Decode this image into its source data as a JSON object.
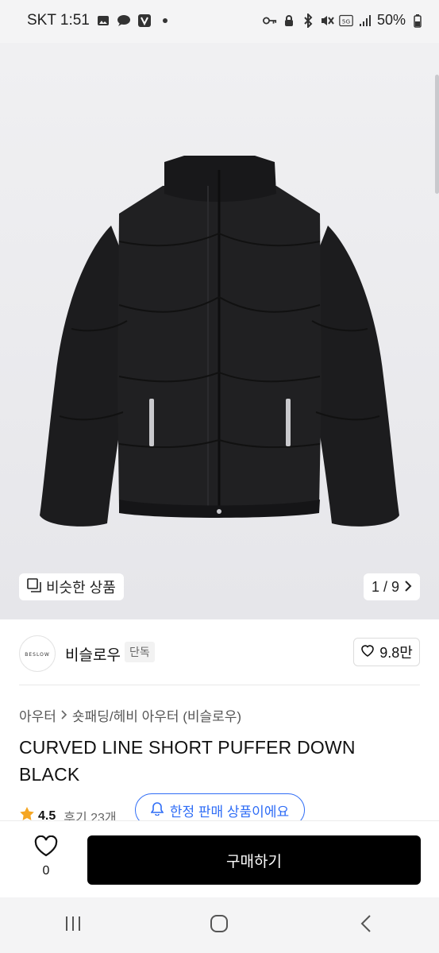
{
  "status_bar": {
    "carrier_time": "SKT 1:51",
    "battery": "50%",
    "network": "5G",
    "left_icons": [
      "image-icon",
      "chat-bubble-icon",
      "v-app-icon",
      "dot-icon"
    ],
    "right_icons": [
      "key-icon",
      "lock-icon",
      "bluetooth-icon",
      "mute-icon",
      "5g-icon",
      "signal-icon",
      "battery-icon"
    ]
  },
  "hero": {
    "image_subject": "black puffer jacket",
    "similar_label": "비슷한 상품",
    "counter": "1 / 9"
  },
  "brand": {
    "logo_text": "BESLOW",
    "name": "비슬로우",
    "badge": "단독",
    "likes": "9.8만"
  },
  "product": {
    "breadcrumb": [
      "아우터",
      "숏패딩/헤비 아우터 (비슬로우)"
    ],
    "title": "CURVED LINE SHORT PUFFER DOWN BLACK",
    "rating": "4.5",
    "reviews": "후기 23개",
    "limited_label": "한정 판매 상품이에요"
  },
  "bottom_bar": {
    "wish_count": "0",
    "buy_label": "구매하기"
  },
  "nav": [
    "recent-apps-icon",
    "home-icon",
    "back-icon"
  ],
  "colors": {
    "accent_blue": "#2f6df6",
    "star": "#f5a623",
    "buy_button": "#000000"
  }
}
